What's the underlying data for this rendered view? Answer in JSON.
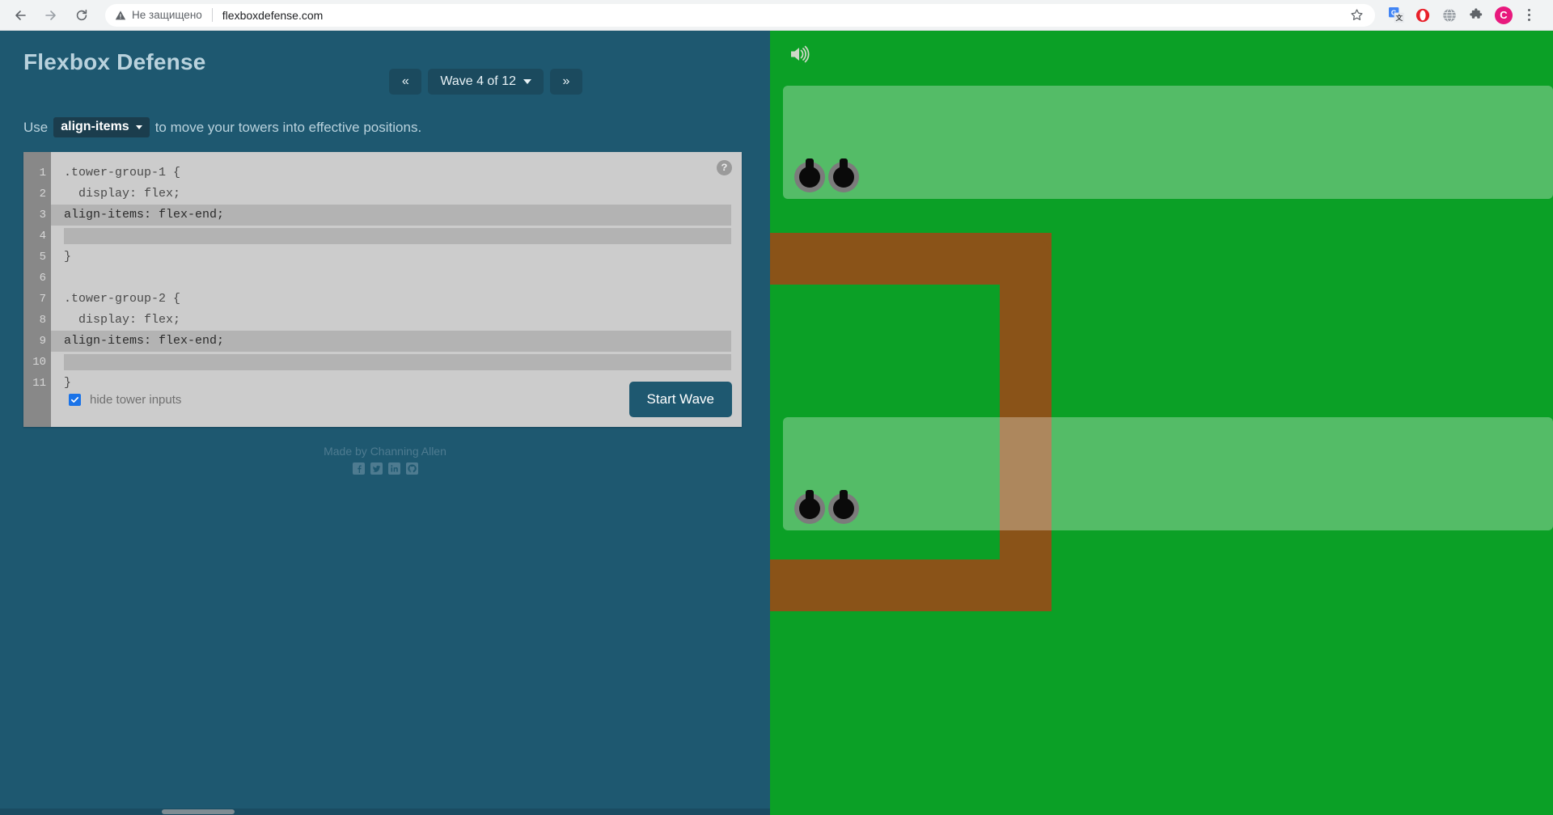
{
  "browser": {
    "back_icon": "back-arrow-icon",
    "forward_icon": "forward-arrow-icon",
    "reload_icon": "reload-icon",
    "security_label": "Не защищено",
    "url": "flexboxdefense.com",
    "bookmark_icon": "star-icon",
    "extensions": [
      {
        "name": "google-translate-icon",
        "label": "G"
      },
      {
        "name": "opera-icon",
        "label": "O"
      },
      {
        "name": "globe-icon",
        "label": "globe"
      },
      {
        "name": "puzzle-extensions-icon",
        "label": "puzzle"
      }
    ],
    "profile_initial": "C",
    "menu_icon": "kebab-menu-icon"
  },
  "header": {
    "title": "Flexbox Defense",
    "prev_wave_label": "«",
    "next_wave_label": "»",
    "wave_label": "Wave 4 of 12"
  },
  "instruction": {
    "prefix": "Use",
    "property": "align-items",
    "suffix": "to move your towers into effective positions."
  },
  "editor": {
    "help_label": "?",
    "line_numbers": [
      "1",
      "2",
      "3",
      "4",
      "5",
      "6",
      "7",
      "8",
      "9",
      "10",
      "11"
    ],
    "lines": [
      {
        "num": "1",
        "text": ".tower-group-1 {",
        "type": "code"
      },
      {
        "num": "2",
        "text": "  display: flex;",
        "type": "code"
      },
      {
        "num": "3",
        "text": "align-items: flex-end;",
        "type": "input"
      },
      {
        "num": "4",
        "text": "",
        "type": "input-blank"
      },
      {
        "num": "5",
        "text": "}",
        "type": "code"
      },
      {
        "num": "6",
        "text": "",
        "type": "code"
      },
      {
        "num": "7",
        "text": ".tower-group-2 {",
        "type": "code"
      },
      {
        "num": "8",
        "text": "  display: flex;",
        "type": "code"
      },
      {
        "num": "9",
        "text": "align-items: flex-end;",
        "type": "input"
      },
      {
        "num": "10",
        "text": "",
        "type": "input-blank"
      },
      {
        "num": "11",
        "text": "}",
        "type": "code"
      }
    ],
    "hide_inputs_label": "hide tower inputs",
    "hide_inputs_checked": true,
    "start_wave_label": "Start Wave"
  },
  "credits": {
    "text": "Made by Channing Allen",
    "socials": [
      {
        "name": "facebook-icon"
      },
      {
        "name": "twitter-icon"
      },
      {
        "name": "linkedin-icon"
      },
      {
        "name": "github-icon"
      }
    ]
  },
  "game": {
    "sound_icon": "sound-on-icon",
    "grass_color": "#0ba026",
    "path_color": "#8a5318",
    "tower_band_color": "rgba(255,255,255,0.30)",
    "tower_groups": [
      {
        "name": "tower-group-1",
        "towers": 2
      },
      {
        "name": "tower-group-2",
        "towers": 2
      }
    ]
  }
}
